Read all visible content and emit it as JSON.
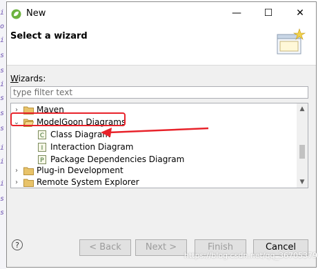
{
  "window": {
    "title": "New",
    "controls": {
      "minimize": "—",
      "maximize": "☐",
      "close": "✕"
    }
  },
  "header": {
    "heading": "Select a wizard"
  },
  "wizards": {
    "label_first": "W",
    "label_rest": "izards:",
    "filter_placeholder": "type filter text",
    "tree": [
      {
        "label": "Maven",
        "type": "folder",
        "expanded": false
      },
      {
        "label": "ModelGoon Diagrams",
        "type": "folder",
        "expanded": true
      },
      {
        "label": "Class Diagram",
        "type": "item",
        "icon_letter": "C"
      },
      {
        "label": "Interaction Diagram",
        "type": "item",
        "icon_letter": "I"
      },
      {
        "label": "Package Dependencies Diagram",
        "type": "item",
        "icon_letter": "P"
      },
      {
        "label": "Plug-in Development",
        "type": "folder",
        "expanded": false
      },
      {
        "label": "Remote System Explorer",
        "type": "folder",
        "expanded": false
      }
    ]
  },
  "buttons": {
    "help": "?",
    "back": "< Back",
    "next": "Next >",
    "finish": "Finish",
    "cancel": "Cancel"
  },
  "watermark": "https://blog.csdn.net/qq_36705379",
  "colors": {
    "highlight": "#e8222a",
    "folder": "#e8c36a",
    "window_bg": "#f0f0f0"
  }
}
